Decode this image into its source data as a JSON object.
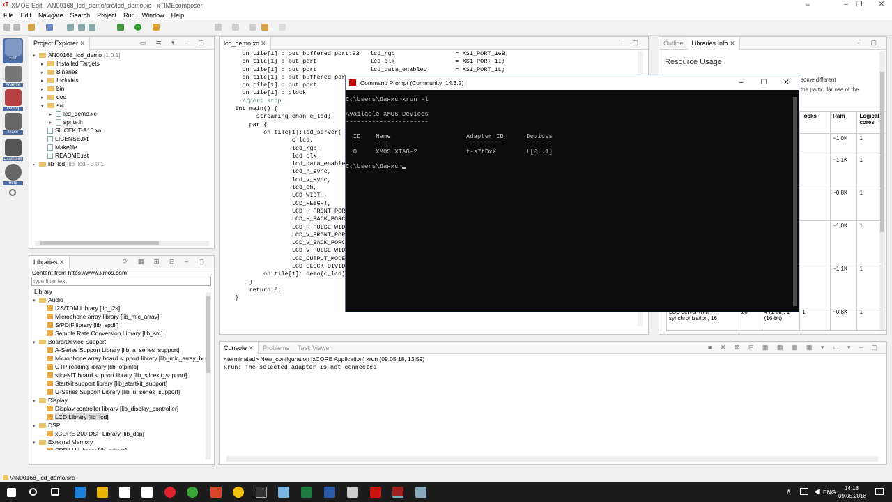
{
  "window": {
    "title": "XMOS Edit - AN00168_lcd_demo/src/lcd_demo.xc - xTIMEcomposer",
    "logo": "xT"
  },
  "menu": [
    "File",
    "Edit",
    "Navigate",
    "Search",
    "Project",
    "Run",
    "Window",
    "Help"
  ],
  "perspectives": [
    {
      "label": "Edit",
      "icon": "pencil-icon"
    },
    {
      "label": "Analyze",
      "icon": "magnifier-icon"
    },
    {
      "label": "Debug",
      "icon": "bug-icon"
    },
    {
      "label": "Trace",
      "icon": "trace-icon"
    },
    {
      "label": "Examples",
      "icon": "database-icon"
    },
    {
      "label": "Help",
      "icon": "question-icon"
    }
  ],
  "project_explorer": {
    "title": "Project Explorer",
    "items": [
      {
        "name": "AN00168_lcd_demo",
        "suffix": "[1.0.1]",
        "depth": 0,
        "kind": "project"
      },
      {
        "name": "Installed Targets",
        "depth": 1,
        "kind": "folder"
      },
      {
        "name": "Binaries",
        "depth": 1,
        "kind": "folder"
      },
      {
        "name": "Includes",
        "depth": 1,
        "kind": "folder"
      },
      {
        "name": "bin",
        "depth": 1,
        "kind": "folder"
      },
      {
        "name": "doc",
        "depth": 1,
        "kind": "folder"
      },
      {
        "name": "src",
        "depth": 1,
        "kind": "folder"
      },
      {
        "name": "lcd_demo.xc",
        "depth": 2,
        "kind": "file"
      },
      {
        "name": "sprite.h",
        "depth": 2,
        "kind": "file"
      },
      {
        "name": "SLICEKIT-A16.xn",
        "depth": 1,
        "kind": "file"
      },
      {
        "name": "LICENSE.txt",
        "depth": 1,
        "kind": "file"
      },
      {
        "name": "Makefile",
        "depth": 1,
        "kind": "file"
      },
      {
        "name": "README.rst",
        "depth": 1,
        "kind": "file"
      },
      {
        "name": "lib_lcd",
        "suffix": "[lib_lcd - 3.0.1]",
        "depth": 0,
        "kind": "project"
      }
    ]
  },
  "libraries": {
    "title": "Libraries",
    "content_from": "Content from https://www.xmos.com",
    "filter_placeholder": "type filter text",
    "root": "Library",
    "items": [
      {
        "name": "Audio",
        "group": true
      },
      {
        "name": "I2S/TDM Library [lib_i2s]"
      },
      {
        "name": "Microphone array library [lib_mic_array]"
      },
      {
        "name": "S/PDIF library [lib_spdif]"
      },
      {
        "name": "Sample Rate Conversion Library [lib_src]"
      },
      {
        "name": "Board/Device Support",
        "group": true
      },
      {
        "name": "A-Series Support Library [lib_a_series_support]"
      },
      {
        "name": "Microphone array board support library [lib_mic_array_boa"
      },
      {
        "name": "OTP reading library [lib_otpinfo]"
      },
      {
        "name": "sliceKIT board support library [lib_slicekit_support]"
      },
      {
        "name": "Startkit support library [lib_startkit_support]"
      },
      {
        "name": "U-Series Support Library [lib_u_series_support]"
      },
      {
        "name": "Display",
        "group": true
      },
      {
        "name": "Display controller library [lib_display_controller]"
      },
      {
        "name": "LCD Library [lib_lcd]",
        "selected": true
      },
      {
        "name": "DSP",
        "group": true
      },
      {
        "name": "xCORE-200 DSP Library [lib_dsp]"
      },
      {
        "name": "External Memory",
        "group": true
      },
      {
        "name": "SDRAM Library [lib_sdram]"
      }
    ]
  },
  "editor": {
    "tab": "lcd_demo.xc",
    "lines": [
      "    on tile[1] : out buffered port:32   lcd_rgb                 = XS1_PORT_16B;",
      "    on tile[1] : out port               lcd_clk                 = XS1_PORT_1I;",
      "    on tile[1] : out port               lcd_data_enabled        = XS1_PORT_1L;",
      "    on tile[1] : out buffered port",
      "    on tile[1] : out port",
      "    on tile[1] : clock",
      "    //port stop",
      "",
      "  int main() {",
      "        streaming chan c_lcd;",
      "      par {",
      "          on tile[1]:lcd_server(",
      "                  c_lcd,",
      "                  lcd_rgb,",
      "                  lcd_clk,",
      "                  lcd_data_enable",
      "                  lcd_h_sync,",
      "                  lcd_v_sync,",
      "                  lcd_cb,",
      "                  LCD_WIDTH,",
      "                  LCD_HEIGHT,",
      "                  LCD_H_FRONT_POR",
      "                  LCD_H_BACK_PORC",
      "                  LCD_H_PULSE_WID",
      "                  LCD_V_FRONT_POR",
      "                  LCD_V_BACK_PORC",
      "                  LCD_V_PULSE_WID",
      "                  LCD_OUTPUT_MODE",
      "                  LCD_CLOCK_DIVID",
      "          on tile[1]: demo(c_lcd);",
      "      }",
      "      return 0;",
      "  }"
    ]
  },
  "outline": {
    "tab_outline": "Outline",
    "tab_libinfo": "Libraries Info",
    "heading": "Resource Usage",
    "frag1": "some different",
    "frag2": "the particular use of the",
    "headers": [
      "locks",
      "Ram",
      "Logical cores"
    ],
    "rows": [
      [
        "",
        "~1.0K",
        "1"
      ],
      [
        "",
        "~1.1K",
        "1"
      ],
      [
        "",
        "~0.8K",
        "1"
      ],
      [
        "",
        "~1.0K",
        "1"
      ],
      [
        "",
        "~1.1K",
        "1"
      ]
    ],
    "last_row": {
      "desc": "LCD server with synchronization, 16",
      "n": "20",
      "port": "4 (1-bit), 1 (16-bit)",
      "locks": "1",
      "ram": "~0.8K",
      "cores": "1"
    }
  },
  "console": {
    "tabs": [
      "Console",
      "Problems",
      "Task Viewer"
    ],
    "terminated": "<terminated> New_configuration [xCORE Application] xrun (09.05.18, 13:59)",
    "output": "xrun: The selected adapter is not connected"
  },
  "cmd": {
    "title": "Command Prompt (Community_14.3.2)",
    "lines": [
      "C:\\Users\\Данис>xrun -l",
      "",
      "Available XMOS Devices",
      "----------------------",
      "",
      "  ID    Name                    Adapter ID      Devices",
      "  --    ----                    ----------      -------",
      "  0     XMOS XTAG-2             t-s7tDxX        L[0..1]",
      "",
      "C:\\Users\\Данис>"
    ]
  },
  "statusbar": {
    "path": "/AN00168_lcd_demo/src"
  },
  "taskbar": {
    "lang": "ENG",
    "time": "14:18",
    "date": "09.05.2018"
  }
}
